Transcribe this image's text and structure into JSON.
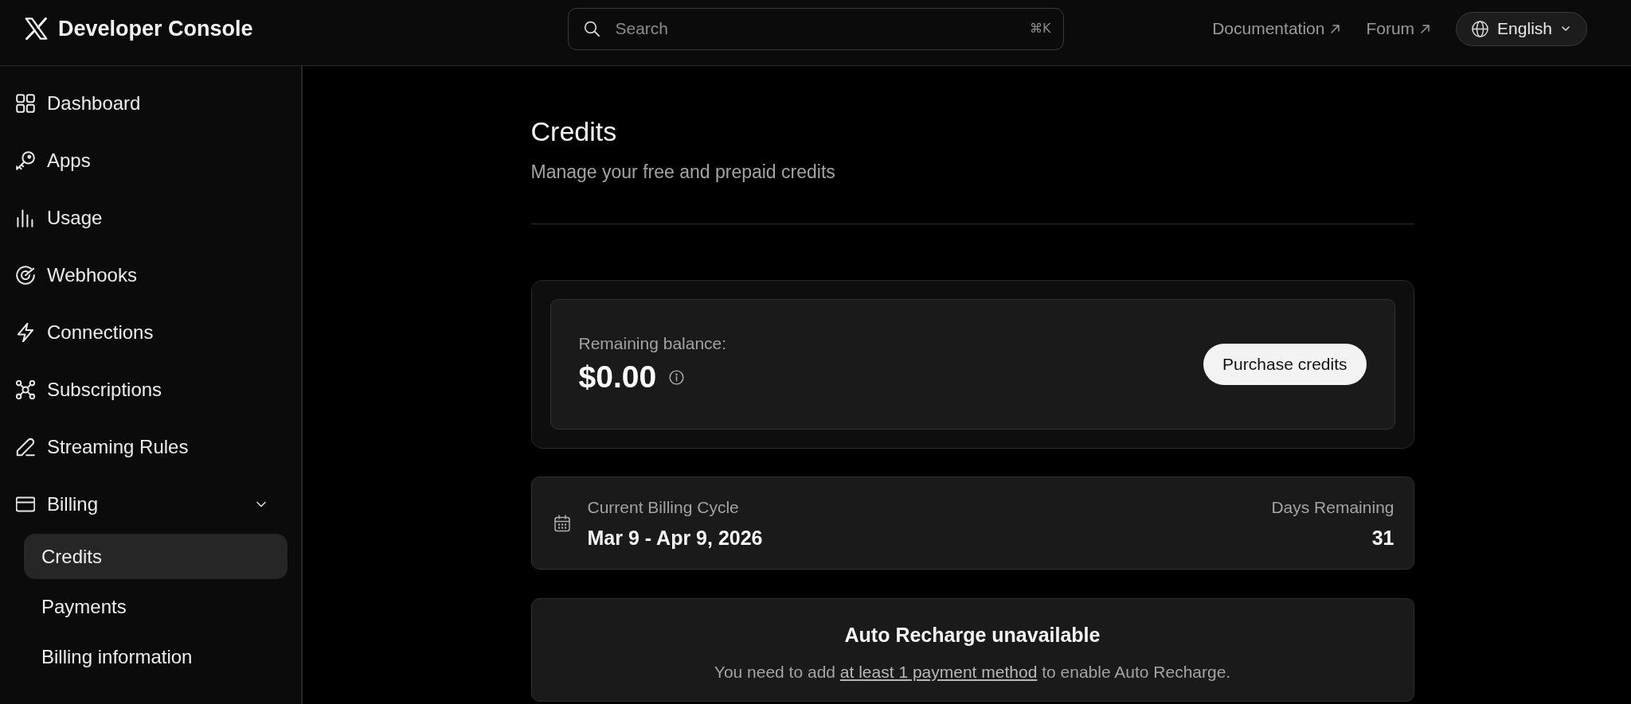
{
  "top_bar": {
    "title": "Developer Console",
    "search": {
      "placeholder": "Search",
      "shortcut": "⌘K"
    },
    "links": [
      "Documentation",
      "Forum"
    ],
    "language": "English"
  },
  "sidebar": {
    "items": [
      {
        "label": "Dashboard",
        "selected": false
      },
      {
        "label": "Apps",
        "selected": false
      },
      {
        "label": "Usage",
        "selected": false
      },
      {
        "label": "Webhooks",
        "selected": false
      },
      {
        "label": "Connections",
        "selected": false
      },
      {
        "label": "Subscriptions",
        "selected": false
      },
      {
        "label": "Streaming Rules",
        "selected": false
      },
      {
        "label": "Billing",
        "selected": false,
        "expanded": true,
        "children": [
          {
            "label": "Credits",
            "selected": true
          },
          {
            "label": "Payments",
            "selected": false
          },
          {
            "label": "Billing information",
            "selected": false
          }
        ]
      }
    ]
  },
  "page": {
    "title": "Credits",
    "subtitle": "Manage your free and prepaid credits"
  },
  "balance": {
    "label": "Remaining balance:",
    "amount": "$0.00",
    "button": "Purchase credits"
  },
  "billing_cycle": {
    "label": "Current Billing Cycle",
    "dates": "Mar 9 - Apr 9, 2026",
    "remaining_label": "Days Remaining",
    "remaining": "31"
  },
  "auto_recharge": {
    "title": "Auto Recharge unavailable",
    "message_before": "You need to add",
    "link": "at least 1 payment method",
    "message_after": "to enable Auto Recharge."
  }
}
